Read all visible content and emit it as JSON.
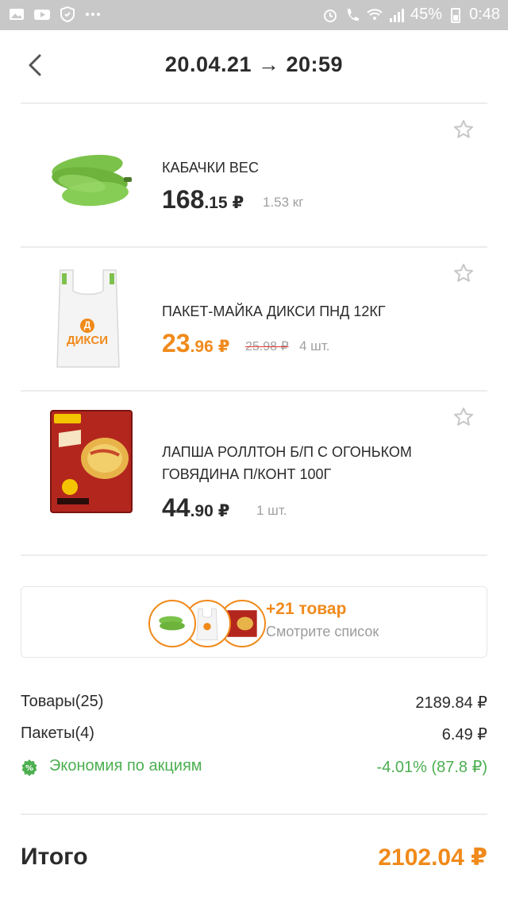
{
  "status_bar": {
    "battery": "45%",
    "time": "0:48"
  },
  "header": {
    "title": "20.04.21 → 20:59"
  },
  "items": [
    {
      "name": "КАБАЧКИ ВЕС",
      "price_int": "168",
      "price_frac": ".15",
      "currency": "₽",
      "quantity": "1.53 кг",
      "old_price": ""
    },
    {
      "name": "ПАКЕТ-МАЙКА ДИКСИ ПНД 12КГ",
      "price_int": "23",
      "price_frac": ".96",
      "currency": "₽",
      "old_price": "25.98 ₽",
      "quantity": "4 шт.",
      "bag_brand": "ДИКСИ",
      "bag_logo_letter": "Д"
    },
    {
      "name_line1": "ЛАПША РОЛЛТОН Б/П С ОГОНЬКОМ",
      "name_line2": "ГОВЯДИНА П/КОНТ 100Г",
      "price_int": "44",
      "price_frac": ".90",
      "currency": "₽",
      "quantity": "1 шт.",
      "old_price": ""
    }
  ],
  "more": {
    "count": "+21 товар",
    "subtitle": "Смотрите список"
  },
  "summary": {
    "goods_label": "Товары(25)",
    "goods_value": "2189.84 ₽",
    "bags_label": "Пакеты(4)",
    "bags_value": "6.49 ₽",
    "savings_label": "Экономия по акциям",
    "savings_value": "-4.01% (87.8 ₽)"
  },
  "total": {
    "label": "Итого",
    "value": "2102.04 ₽"
  },
  "colors": {
    "accent": "#f08a1b",
    "green": "#4caf50",
    "strike": "#e53935"
  }
}
